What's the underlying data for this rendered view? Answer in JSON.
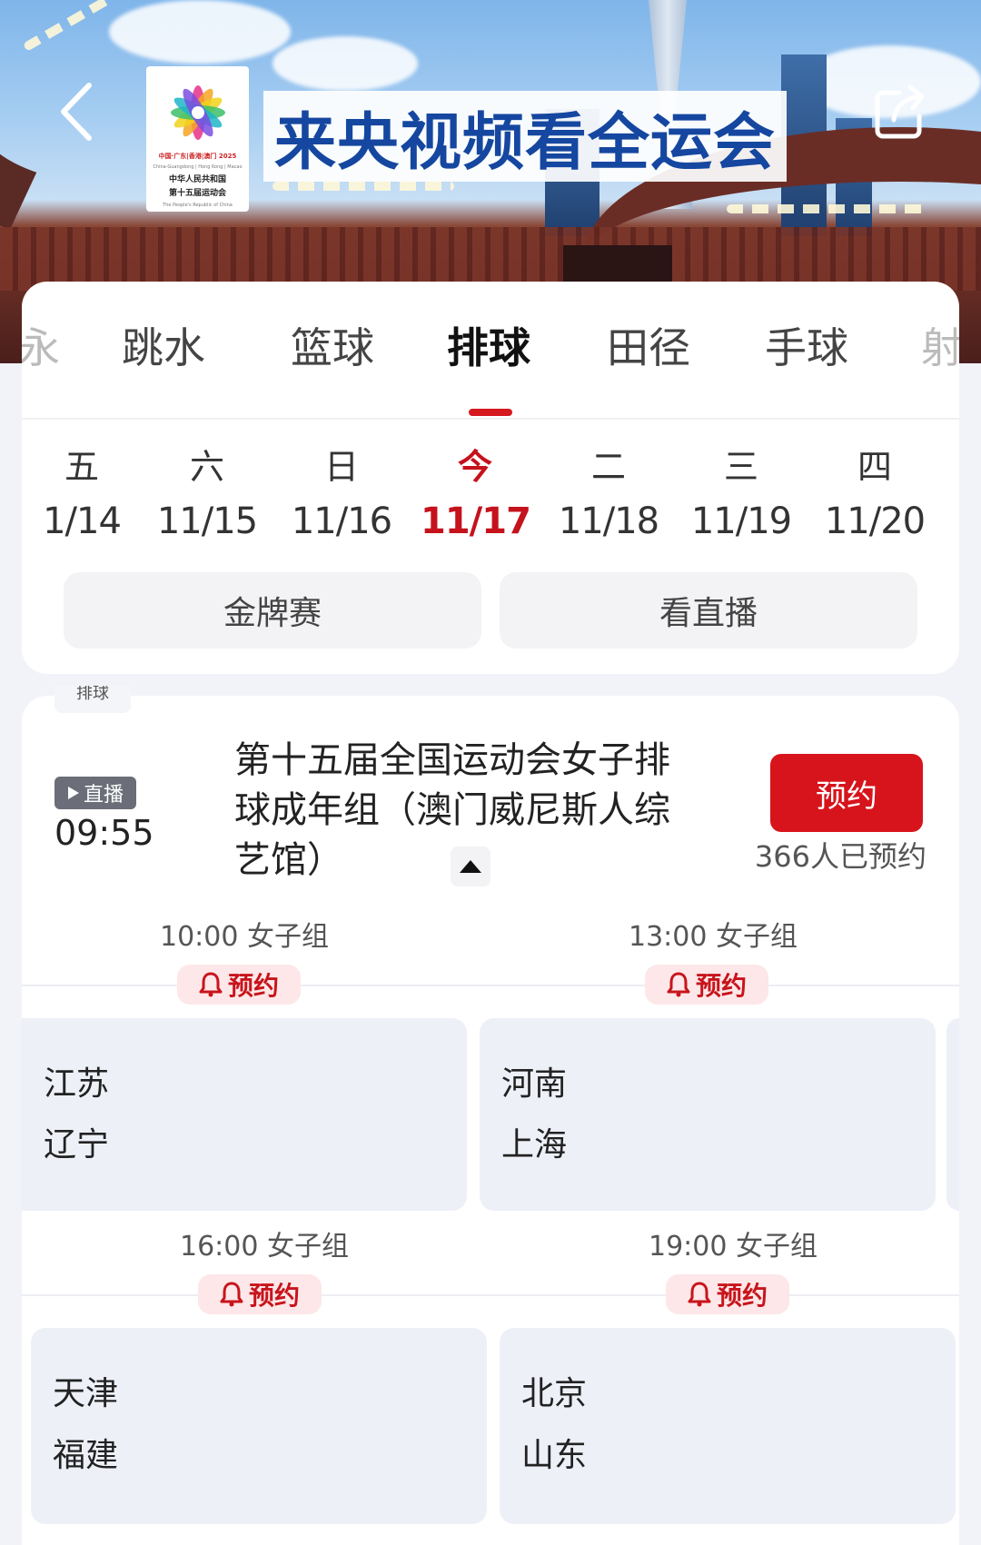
{
  "banner": {
    "title": "来央视频看全运会",
    "logo": {
      "line1": "中国·广东|香港|澳门 2025",
      "line2": "China·Guangdong | Hong Kong | Macao",
      "cn1": "中华人民共和国",
      "cn2": "第十五届运动会",
      "en": "The People's Republic of China"
    },
    "icons": {
      "back": "back-chevron-icon",
      "share": "share-icon"
    }
  },
  "sport_tabs": [
    "永",
    "跳水",
    "篮球",
    "排球",
    "田径",
    "手球",
    "射"
  ],
  "active_sport": "排球",
  "dates": [
    {
      "weekday": "五",
      "date": "1/14"
    },
    {
      "weekday": "六",
      "date": "11/15"
    },
    {
      "weekday": "日",
      "date": "11/16"
    },
    {
      "weekday": "今",
      "date": "11/17"
    },
    {
      "weekday": "二",
      "date": "11/18"
    },
    {
      "weekday": "三",
      "date": "11/19"
    },
    {
      "weekday": "四",
      "date": "11/20"
    }
  ],
  "active_date": "11/17",
  "filters": {
    "gold": "金牌赛",
    "live": "看直播"
  },
  "event": {
    "sport_chip": "排球",
    "live_label": "直播",
    "time": "09:55",
    "title": "第十五届全国运动会女子排球成年组（澳门威尼斯人综艺馆）",
    "reserve_label": "预约",
    "reserve_count": "366人已预约"
  },
  "matches": [
    {
      "time": "10:00 女子组",
      "remind": "预约",
      "teams": [
        "江苏",
        "辽宁"
      ]
    },
    {
      "time": "13:00 女子组",
      "remind": "预约",
      "teams": [
        "河南",
        "上海"
      ]
    },
    {
      "time": "16:00 女子组",
      "remind": "预约",
      "teams": [
        "天津",
        "福建"
      ]
    },
    {
      "time": "19:00 女子组",
      "remind": "预约",
      "teams": [
        "北京",
        "山东"
      ]
    }
  ],
  "colors": {
    "accent": "#d7141c",
    "title_blue": "#1547a0",
    "card_bg": "#eef0f8"
  }
}
